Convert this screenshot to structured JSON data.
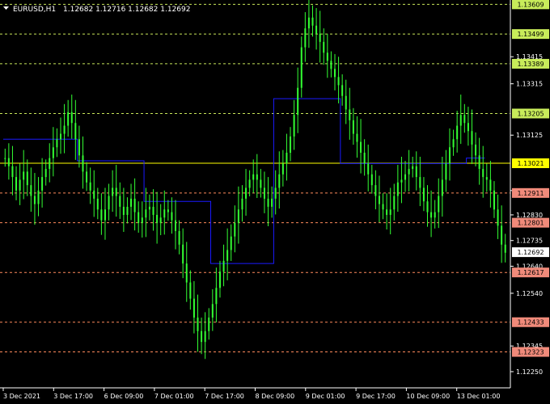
{
  "window": {
    "symbol_label": "EURUSD,H1",
    "ohlc_label": "1.12682 1.12716 1.12682 1.12692",
    "menu_icon": "triangle-down-icon"
  },
  "colors": {
    "background": "#000000",
    "candle": "#33ff33",
    "indicator_line": "#1a1aff",
    "support_line": "#ff8a5c",
    "resistance_line": "#c8e65a",
    "current_level_line": "#ffff00",
    "axis_text": "#ffffff",
    "support_badge": "#f08a7a",
    "resistance_badge": "#c8ec5a",
    "current_level_badge": "#ffff00",
    "price_badge": "#ffffff"
  },
  "chart_data": {
    "type": "line",
    "title": "EURUSD,H1",
    "x": [
      "3 Dec 2021",
      "3 Dec 17:00",
      "6 Dec 09:00",
      "7 Dec 01:00",
      "7 Dec 17:00",
      "8 Dec 09:00",
      "9 Dec 01:00",
      "9 Dec 17:00",
      "10 Dec 09:00",
      "13 Dec 01:00"
    ],
    "ylim": [
      1.1222,
      1.1361
    ],
    "y_ticks": [
      "1.13415",
      "1.13315",
      "1.13125",
      "1.12920",
      "1.12830",
      "1.12735",
      "1.12640",
      "1.12540",
      "1.12345",
      "1.12250"
    ],
    "grid": false,
    "price_series": [
      1.1304,
      1.1301,
      1.1297,
      1.1292,
      1.1296,
      1.1299,
      1.1294,
      1.129,
      1.1287,
      1.1292,
      1.1297,
      1.13,
      1.1304,
      1.1308,
      1.1311,
      1.1313,
      1.1316,
      1.1321,
      1.1317,
      1.1311,
      1.1305,
      1.1299,
      1.1295,
      1.1292,
      1.1289,
      1.1285,
      1.1281,
      1.1285,
      1.129,
      1.1293,
      1.129,
      1.1286,
      1.1283,
      1.1286,
      1.1289,
      1.1284,
      1.128,
      1.1282,
      1.1285,
      1.1286,
      1.1283,
      1.128,
      1.1282,
      1.1285,
      1.1284,
      1.1281,
      1.1277,
      1.1272,
      1.1265,
      1.1258,
      1.1252,
      1.1245,
      1.124,
      1.1236,
      1.124,
      1.1245,
      1.125,
      1.1256,
      1.1262,
      1.1266,
      1.127,
      1.1275,
      1.128,
      1.1285,
      1.1289,
      1.1293,
      1.1296,
      1.1298,
      1.1296,
      1.1293,
      1.1289,
      1.1286,
      1.1289,
      1.1293,
      1.1298,
      1.1302,
      1.1306,
      1.1312,
      1.132,
      1.133,
      1.1345,
      1.1352,
      1.1356,
      1.1353,
      1.135,
      1.1347,
      1.1343,
      1.134,
      1.1337,
      1.1334,
      1.1331,
      1.1327,
      1.1322,
      1.1318,
      1.1313,
      1.131,
      1.1306,
      1.1302,
      1.1298,
      1.1294,
      1.129,
      1.1287,
      1.1285,
      1.1283,
      1.1285,
      1.129,
      1.1295,
      1.1296,
      1.1298,
      1.13,
      1.1301,
      1.1297,
      1.1293,
      1.1288,
      1.1284,
      1.1282,
      1.1284,
      1.129,
      1.1296,
      1.1302,
      1.1308,
      1.1311,
      1.1316,
      1.132,
      1.1317,
      1.1314,
      1.1309,
      1.1305,
      1.13,
      1.1297,
      1.1296,
      1.1292,
      1.1285,
      1.1279,
      1.1272,
      1.1269
    ],
    "indicator_segments": [
      {
        "from": 0,
        "to": 20,
        "value": 1.1311
      },
      {
        "from": 20,
        "to": 38,
        "value": 1.1303
      },
      {
        "from": 38,
        "to": 56,
        "value": 1.1288
      },
      {
        "from": 56,
        "to": 73,
        "value": 1.1265
      },
      {
        "from": 73,
        "to": 91,
        "value": 1.1326
      },
      {
        "from": 91,
        "to": 115,
        "value": 1.1302
      },
      {
        "from": 115,
        "to": 125,
        "value": 1.1302
      },
      {
        "from": 125,
        "to": 130,
        "value": 1.1304
      }
    ],
    "support_levels": [
      "1.12911",
      "1.12801",
      "1.12617",
      "1.12433",
      "1.12323"
    ],
    "resistance_levels": [
      "1.13609",
      "1.13499",
      "1.13389",
      "1.13205"
    ],
    "current_level": "1.13021",
    "current_price": "1.12692"
  }
}
